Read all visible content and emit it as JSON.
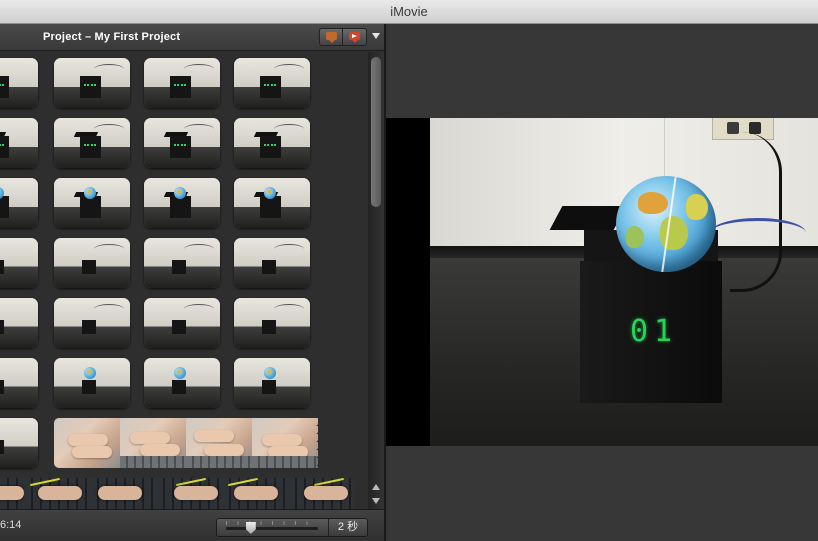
{
  "window": {
    "title": "iMovie"
  },
  "project": {
    "title": "Project – My First Project",
    "duration": "6:14"
  },
  "toolbar": {
    "icons": [
      "comment-bubble-icon",
      "chapter-marker-icon",
      "menu-arrow-icon"
    ]
  },
  "zoom": {
    "value_label": "2 秒",
    "level": 0.27
  },
  "viewer": {
    "lcd_display": "01"
  },
  "colors": {
    "titlebar": "#dcdcdc",
    "pane_background": "#2e2e2e",
    "viewer_background": "#373737",
    "lcd_green": "#27d35a",
    "warning_yellow": "#f2d21b"
  }
}
